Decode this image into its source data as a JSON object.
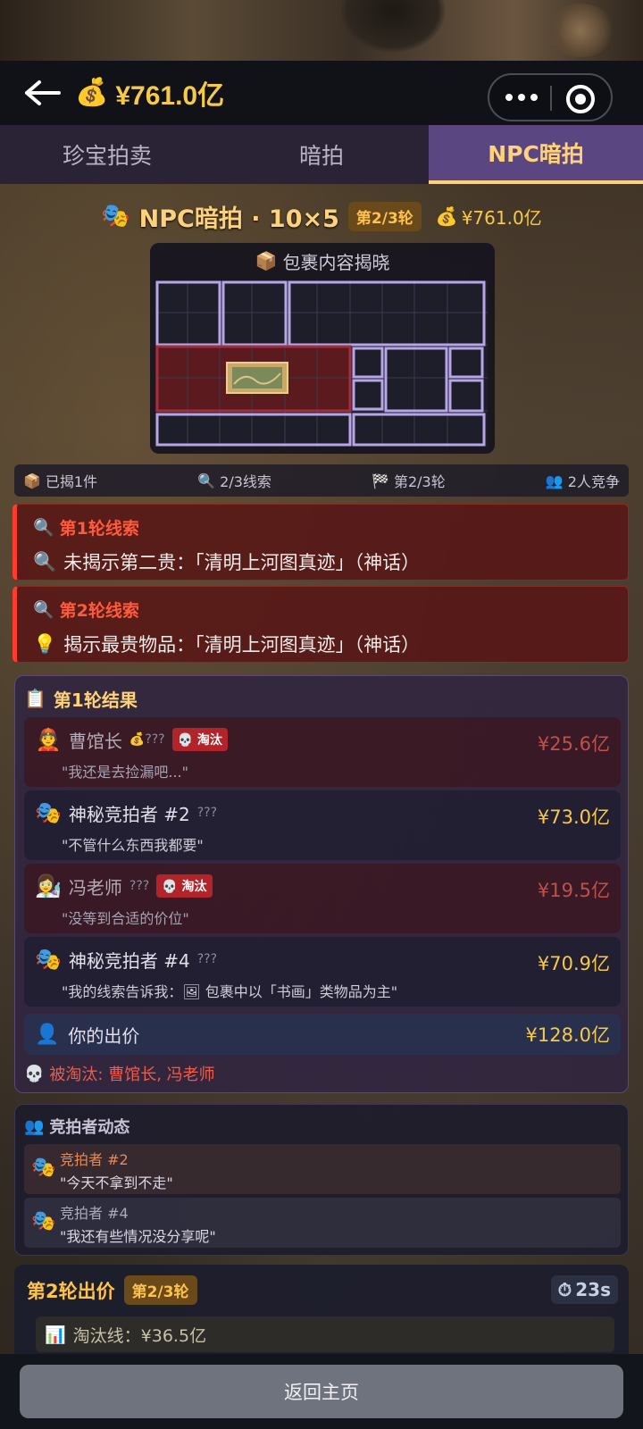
{
  "nav": {
    "amount": "¥761.0亿"
  },
  "tabs": [
    {
      "label": "珍宝拍卖",
      "active": false
    },
    {
      "label": "暗拍",
      "active": false
    },
    {
      "label": "NPC暗拍",
      "active": true
    }
  ],
  "game": {
    "title": "NPC暗拍 · 10×5",
    "round_badge": "第2/3轮",
    "money": "¥761.0亿"
  },
  "grid": {
    "title": "包裹内容揭晓"
  },
  "stats": {
    "revealed": "已揭1件",
    "clues": "2/3线索",
    "round": "第2/3轮",
    "bidders": "2人竞争"
  },
  "clues": [
    {
      "title": "第1轮线索",
      "text": "未揭示第二贵：「清明上河图真迹」（神话）"
    },
    {
      "title": "第2轮线索",
      "text": "揭示最贵物品：「清明上河图真迹」（神话）"
    }
  ],
  "results": {
    "title": "第1轮结果",
    "rows": [
      {
        "avatar": "👲",
        "name": "曹馆长",
        "hidden": "💰???",
        "badge": "💀 淘汰",
        "price": "¥25.6亿",
        "quote": "\"我还是去捡漏吧...\"",
        "eliminated": true
      },
      {
        "avatar": "🎭",
        "name": "神秘竞拍者 #2",
        "hidden": "???",
        "badge": "",
        "price": "¥73.0亿",
        "quote": "\"不管什么东西我都要\"",
        "eliminated": false
      },
      {
        "avatar": "👩‍🔬",
        "name": "冯老师",
        "hidden": "???",
        "badge": "💀 淘汰",
        "price": "¥19.5亿",
        "quote": "\"没等到合适的价位\"",
        "eliminated": true
      },
      {
        "avatar": "🎭",
        "name": "神秘竞拍者 #4",
        "hidden": "???",
        "badge": "",
        "price": "¥70.9亿",
        "quote": "\"我的线索告诉我：🖼 包裹中以「书画」类物品为主\"",
        "eliminated": false
      }
    ],
    "my_bid_label": "你的出价",
    "my_bid_amount": "¥128.0亿",
    "eliminated_line": "被淘汰: 曹馆长, 冯老师"
  },
  "activity": {
    "title": "竞拍者动态",
    "items": [
      {
        "who": "竞拍者 #2",
        "say": "\"今天不拿到不走\""
      },
      {
        "who": "竞拍者 #4",
        "say": "\"我还有些情况没分享呢\""
      }
    ]
  },
  "round2": {
    "title": "第2轮出价",
    "badge": "第2/3轮",
    "timer": "23s",
    "elim_line": "淘汰线：¥36.5亿"
  },
  "bottom": {
    "home_label": "返回主页"
  },
  "colors": {
    "accent_gold": "#f7c948",
    "tab_active": "#5a4680",
    "danger": "#ff3b2f"
  }
}
